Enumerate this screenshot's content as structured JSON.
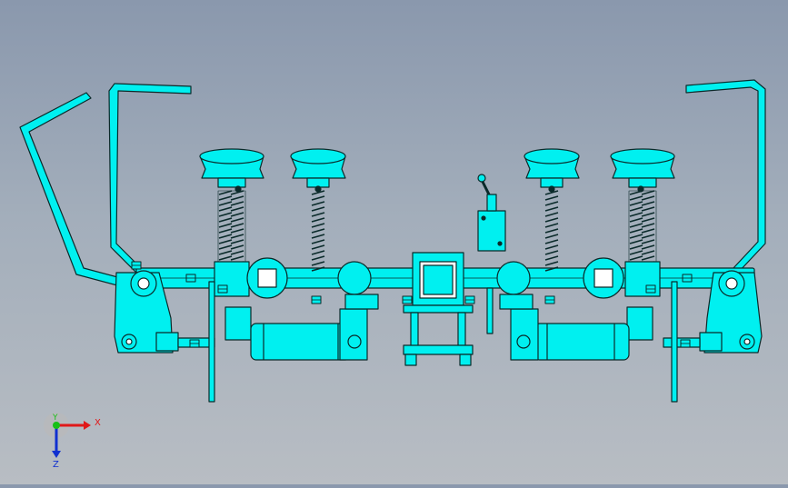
{
  "viewport": {
    "background_top": "#8a98ad",
    "background_bottom": "#b8bdc3",
    "model_fill": "#00f0f0",
    "model_edge": "#0a2a2a"
  },
  "triad": {
    "x_label": "X",
    "y_label": "Y",
    "z_label": "Z",
    "x_color": "#e01818",
    "y_color": "#18c018",
    "z_color": "#1030d0"
  }
}
